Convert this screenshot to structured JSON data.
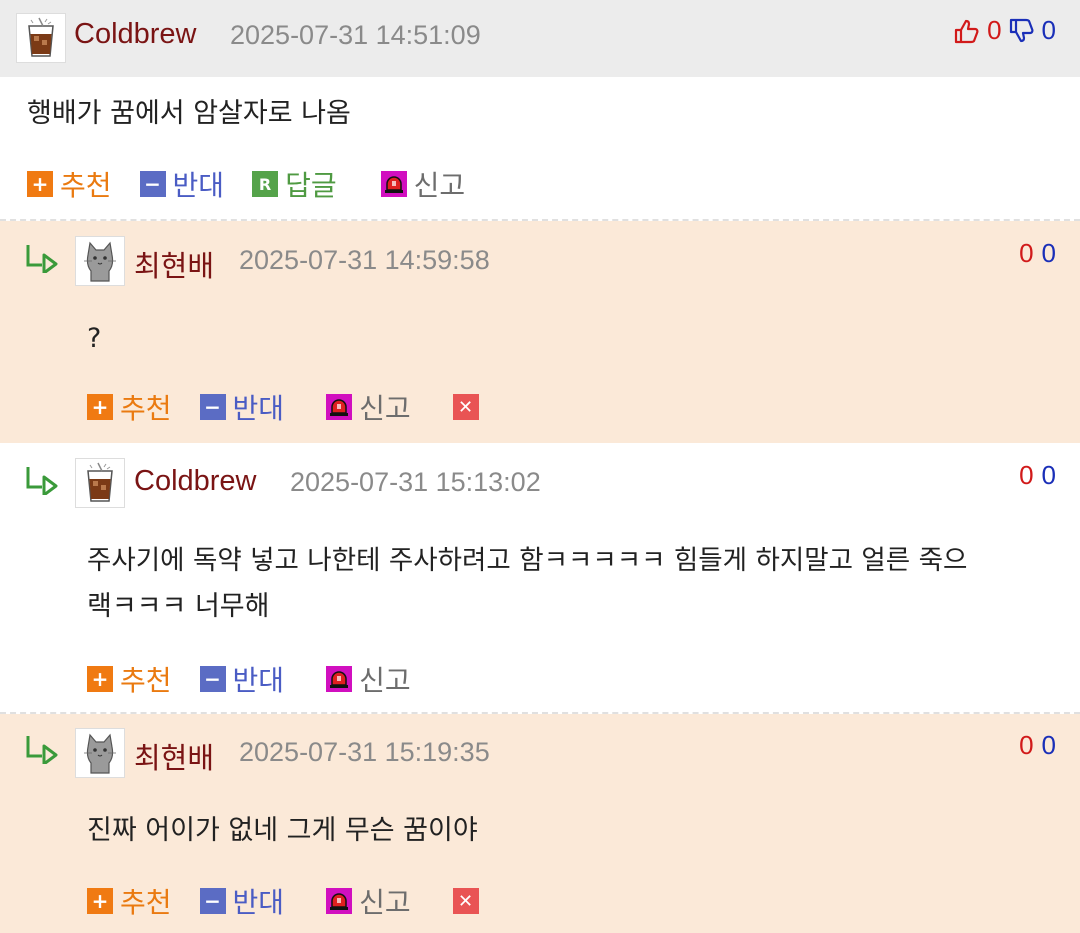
{
  "main_comment": {
    "nickname": "Coldbrew",
    "timestamp": "2025-07-31 14:51:09",
    "up_count": "0",
    "down_count": "0",
    "text": "행배가 꿈에서 암살자로 나옴",
    "actions": {
      "recommend": "추천",
      "oppose": "반대",
      "reply": "답글",
      "report": "신고"
    }
  },
  "replies": [
    {
      "nickname": "최현배",
      "timestamp": "2025-07-31 14:59:58",
      "up_count": "0",
      "down_count": "0",
      "text": "?",
      "actions": {
        "recommend": "추천",
        "oppose": "반대",
        "report": "신고"
      }
    },
    {
      "nickname": "Coldbrew",
      "timestamp": "2025-07-31 15:13:02",
      "up_count": "0",
      "down_count": "0",
      "text_line1": "주사기에 독약 넣고 나한테 주사하려고 함ㅋㅋㅋㅋㅋ 힘들게 하지말고 얼른 죽으",
      "text_line2": "랙ㅋㅋㅋ 너무해",
      "actions": {
        "recommend": "추천",
        "oppose": "반대",
        "report": "신고"
      }
    },
    {
      "nickname": "최현배",
      "timestamp": "2025-07-31 15:19:35",
      "up_count": "0",
      "down_count": "0",
      "text": "진짜 어이가 없네 그게 무슨 꿈이야",
      "actions": {
        "recommend": "추천",
        "oppose": "반대",
        "report": "신고"
      }
    }
  ],
  "colors": {
    "header_bg": "#ececec",
    "reply_bg": "#fbe9d8",
    "nickname": "#7a1414",
    "up": "#d11a1a",
    "down": "#1a2fb8"
  },
  "icons": {
    "avatar_coldbrew": "iced-coffee-icon",
    "avatar_choi": "gray-cat-icon",
    "thumb_up": "thumbs-up-icon",
    "thumb_down": "thumbs-down-icon",
    "reply_arrow": "reply-arrow-icon",
    "recommend": "plus-icon",
    "oppose": "minus-icon",
    "reply": "reply-r-icon",
    "report": "siren-icon",
    "delete": "close-icon"
  }
}
